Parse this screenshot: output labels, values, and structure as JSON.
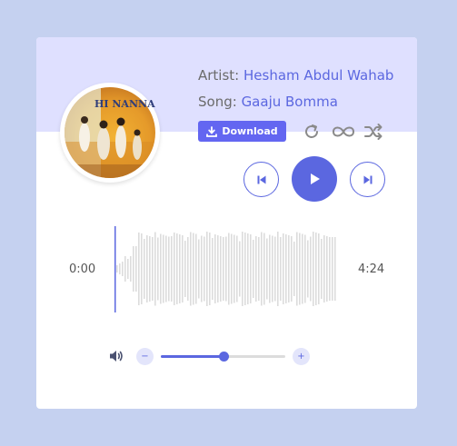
{
  "track": {
    "artist_label": "Artist:",
    "artist_name": "Hesham Abdul Wahab",
    "song_label": "Song:",
    "song_name": "Gaaju Bomma",
    "cover_title": "HI NANNA"
  },
  "actions": {
    "download_label": "Download"
  },
  "icons": {
    "download": "download-icon",
    "repeat": "repeat-icon",
    "loop": "infinity-icon",
    "shuffle": "shuffle-icon",
    "previous": "skip-previous-icon",
    "play": "play-icon",
    "next": "skip-next-icon",
    "volume": "volume-icon"
  },
  "player": {
    "current_time": "0:00",
    "duration": "4:24",
    "progress": 0.0
  },
  "volume": {
    "decrease_label": "−",
    "increase_label": "+",
    "level": 0.5
  },
  "colors": {
    "background": "#c5d1f0",
    "card_header": "#dfe0ff",
    "accent": "#5b67e0",
    "download_button": "#6366f1",
    "waveform": "#dcdcdc"
  }
}
